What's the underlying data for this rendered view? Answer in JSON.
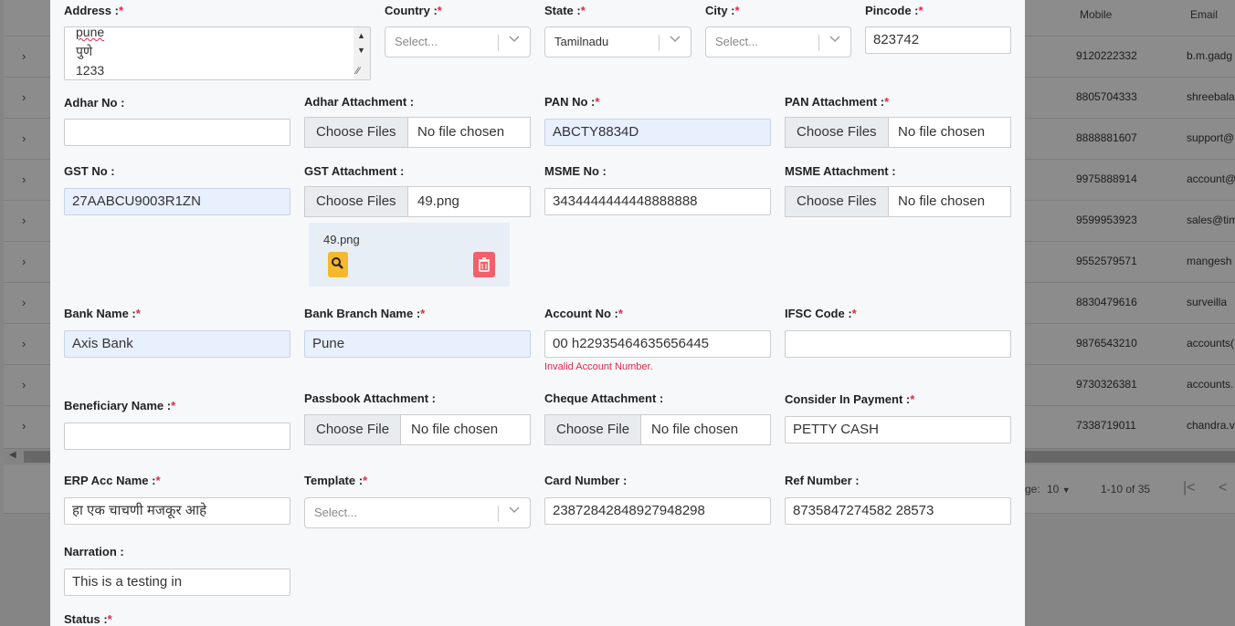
{
  "background_table": {
    "headers": {
      "mobile": "Mobile",
      "email": "Email"
    },
    "rows": [
      {
        "mobile": "9120222332",
        "email": "b.m.gadg"
      },
      {
        "mobile": "8805704333",
        "email": "shreebala"
      },
      {
        "mobile": "8888881607",
        "email": "support@"
      },
      {
        "mobile": "9975888914",
        "email": "account@"
      },
      {
        "mobile": "9599953923",
        "email": "sales@tim"
      },
      {
        "mobile": "9552579571",
        "email": "mangesh"
      },
      {
        "mobile": "8830479616",
        "email": "surveilla"
      },
      {
        "mobile": "9876543210",
        "email": "accounts("
      },
      {
        "mobile": "9730326381",
        "email": "accounts."
      },
      {
        "mobile": "7338719011",
        "email": "chandra.v"
      }
    ],
    "pager": {
      "page_size_label": "ge:",
      "page_size": "10",
      "range": "1-10 of 35"
    }
  },
  "form": {
    "address": {
      "label": "Address :",
      "lines": [
        "pune",
        "पुणे",
        "1233"
      ]
    },
    "country": {
      "label": "Country :",
      "placeholder": "Select..."
    },
    "state": {
      "label": "State :",
      "value": "Tamilnadu"
    },
    "city": {
      "label": "City :",
      "placeholder": "Select..."
    },
    "pincode": {
      "label": "Pincode :",
      "value": "823742"
    },
    "adhar_no": {
      "label": "Adhar No :",
      "value": ""
    },
    "adhar_attachment": {
      "label": "Adhar Attachment :",
      "button": "Choose Files",
      "file": "No file chosen"
    },
    "pan_no": {
      "label": "PAN No :",
      "value": "ABCTY8834D"
    },
    "pan_attachment": {
      "label": "PAN Attachment :",
      "button": "Choose Files",
      "file": "No file chosen"
    },
    "gst_no": {
      "label": "GST No :",
      "value": "27AABCU9003R1ZN"
    },
    "gst_attachment": {
      "label": "GST Attachment :",
      "button": "Choose Files",
      "file": "49.png",
      "preview_name": "49.png"
    },
    "msme_no": {
      "label": "MSME No :",
      "value": "3434444444448888888"
    },
    "msme_attachment": {
      "label": "MSME Attachment :",
      "button": "Choose Files",
      "file": "No file chosen"
    },
    "bank_name": {
      "label": "Bank Name :",
      "value": "Axis Bank"
    },
    "bank_branch": {
      "label": "Bank Branch Name :",
      "value": "Pune"
    },
    "account_no": {
      "label": "Account No :",
      "value": "00  h22935464635656445",
      "error": "Invalid Account Number."
    },
    "ifsc": {
      "label": "IFSC Code :",
      "value": ""
    },
    "beneficiary": {
      "label": "Beneficiary Name :",
      "value": ""
    },
    "passbook_attachment": {
      "label": "Passbook Attachment :",
      "button": "Choose File",
      "file": "No file chosen"
    },
    "cheque_attachment": {
      "label": "Cheque Attachment :",
      "button": "Choose File",
      "file": "No file chosen"
    },
    "consider_payment": {
      "label": "Consider In Payment :",
      "value": "PETTY CASH"
    },
    "erp_acc_name": {
      "label": "ERP Acc Name :",
      "value": "हा एक चाचणी मजकूर आहे"
    },
    "template": {
      "label": "Template :",
      "placeholder": "Select..."
    },
    "card_number": {
      "label": "Card Number :",
      "value": "23872842848927948298"
    },
    "ref_number": {
      "label": "Ref Number :",
      "value": "8735847274582  28573"
    },
    "narration": {
      "label": "Narration :",
      "value": "This is a testing in"
    },
    "status": {
      "label": "Status :"
    },
    "required_mark": "*"
  }
}
